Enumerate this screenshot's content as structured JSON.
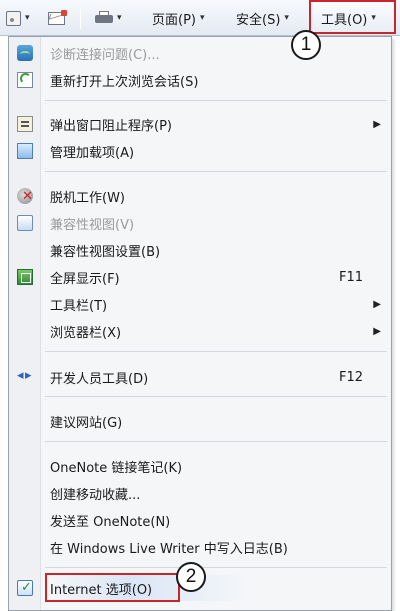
{
  "toolbar": {
    "page_label": "页面(P)",
    "safety_label": "安全(S)",
    "tools_label": "工具(O)",
    "dropdown_arrow": "▾",
    "icons": [
      "rss-feed-icon",
      "mail-icon",
      "print-icon"
    ]
  },
  "menu": {
    "items": [
      {
        "label": "诊断连接问题(C)...",
        "disabled": true,
        "icon": "diagnose-connection-icon"
      },
      {
        "label": "重新打开上次浏览会话(S)",
        "icon": "reopen-session-icon"
      },
      {
        "label": "弹出窗口阻止程序(P)",
        "submenu": true,
        "icon": "popup-blocker-icon"
      },
      {
        "label": "管理加载项(A)",
        "icon": "manage-addons-icon"
      },
      {
        "label": "脱机工作(W)",
        "icon": "work-offline-icon"
      },
      {
        "label": "兼容性视图(V)",
        "disabled": true,
        "icon": "compatibility-view-icon"
      },
      {
        "label": "兼容性视图设置(B)"
      },
      {
        "label": "全屏显示(F)",
        "shortcut": "F11",
        "icon": "fullscreen-icon"
      },
      {
        "label": "工具栏(T)",
        "submenu": true
      },
      {
        "label": "浏览器栏(X)",
        "submenu": true
      },
      {
        "label": "开发人员工具(D)",
        "shortcut": "F12",
        "icon": "developer-tools-icon"
      },
      {
        "label": "建议网站(G)"
      },
      {
        "label": "OneNote 链接笔记(K)"
      },
      {
        "label": "创建移动收藏..."
      },
      {
        "label": "发送至 OneNote(N)"
      },
      {
        "label": "在 Windows Live Writer 中写入日志(B)"
      },
      {
        "label": "Internet 选项(O)",
        "icon": "internet-options-icon"
      }
    ],
    "submenu_arrow": "▶"
  },
  "callouts": {
    "step1": "1",
    "step2": "2"
  },
  "colors": {
    "highlight_border": "#c7262c",
    "toolbar_bg": "#e4eaf3",
    "menu_bg": "#f5f6f8"
  }
}
